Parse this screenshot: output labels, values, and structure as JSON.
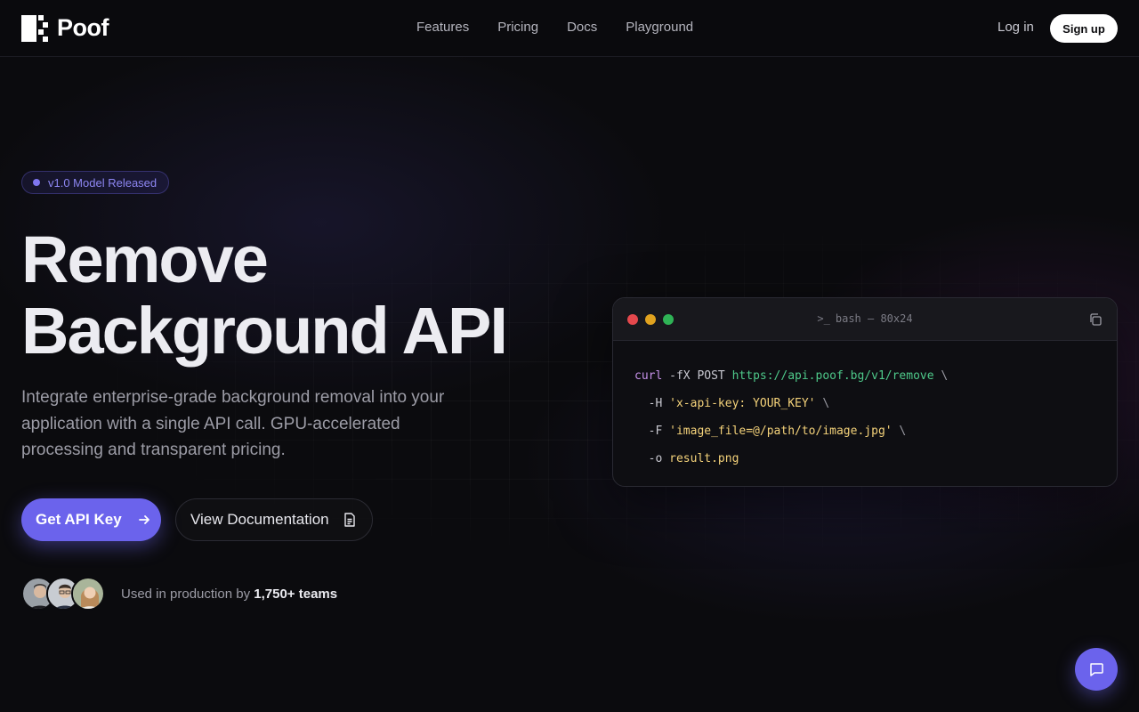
{
  "brand": {
    "name": "Poof"
  },
  "nav": {
    "items": [
      "Features",
      "Pricing",
      "Docs",
      "Playground"
    ],
    "login": "Log in",
    "signup": "Sign up"
  },
  "hero": {
    "badge": "v1.0 Model Released",
    "headline_line1": "Remove",
    "headline_line2": "Background API",
    "subtitle": "Integrate enterprise-grade background removal into your application with a single API call. GPU-accelerated processing and transparent pricing.",
    "primary_cta": "Get API Key",
    "secondary_cta": "View Documentation",
    "social_prefix": "Used in production by",
    "social_count": "1,750+ teams"
  },
  "terminal": {
    "title": "bash — 80x24",
    "lines": [
      {
        "cmd": "curl",
        "flag": "-fX POST",
        "url": "https://api.poof.bg/v1/remove",
        "cont": "\\"
      },
      {
        "flag": "-H",
        "str": "'x-api-key: YOUR_KEY'",
        "cont": "\\"
      },
      {
        "flag": "-F",
        "str": "'image_file=@/path/to/image.jpg'",
        "cont": "\\"
      },
      {
        "flag": "-o",
        "str": "result.png"
      }
    ]
  },
  "colors": {
    "accent": "#6b63ec",
    "background": "#0b0b0e",
    "dot_red": "#e5484d",
    "dot_yellow": "#e0a21f",
    "dot_green": "#2fb356"
  },
  "icons": {
    "arrow": "arrow-right-icon",
    "doc": "document-icon",
    "copy": "copy-icon",
    "chat": "chat-icon"
  }
}
